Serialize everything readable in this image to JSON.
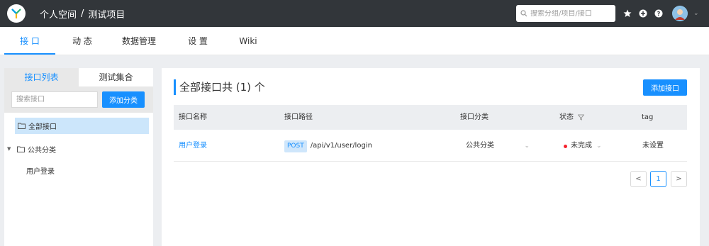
{
  "header": {
    "breadcrumb_space": "个人空间",
    "breadcrumb_sep": "/",
    "breadcrumb_project": "测试项目",
    "search_placeholder": "搜索分组/项目/接口"
  },
  "nav": {
    "tabs": [
      {
        "label": "接 口",
        "active": true
      },
      {
        "label": "动 态",
        "active": false
      },
      {
        "label": "数据管理",
        "active": false
      },
      {
        "label": "设 置",
        "active": false
      },
      {
        "label": "Wiki",
        "active": false
      }
    ]
  },
  "sidebar": {
    "tabs": [
      "接口列表",
      "测试集合"
    ],
    "search_placeholder": "搜索接口",
    "add_category_label": "添加分类",
    "tree": [
      {
        "label": "全部接口",
        "selected": true
      },
      {
        "label": "公共分类",
        "selected": false
      },
      {
        "label": "用户登录",
        "selected": false
      }
    ]
  },
  "main": {
    "title": "全部接口共 (1) 个",
    "add_api_label": "添加接口",
    "columns": [
      "接口名称",
      "接口路径",
      "接口分类",
      "状态",
      "tag"
    ],
    "rows": [
      {
        "name": "用户登录",
        "method": "POST",
        "path": "/api/v1/user/login",
        "category": "公共分类",
        "status": "未完成",
        "tag": "未设置"
      }
    ],
    "pagination": {
      "prev": "<",
      "current": "1",
      "next": ">"
    }
  },
  "colors": {
    "topbar": "#32363a",
    "accent": "#1890ff",
    "status_dot": "#f5222d"
  }
}
